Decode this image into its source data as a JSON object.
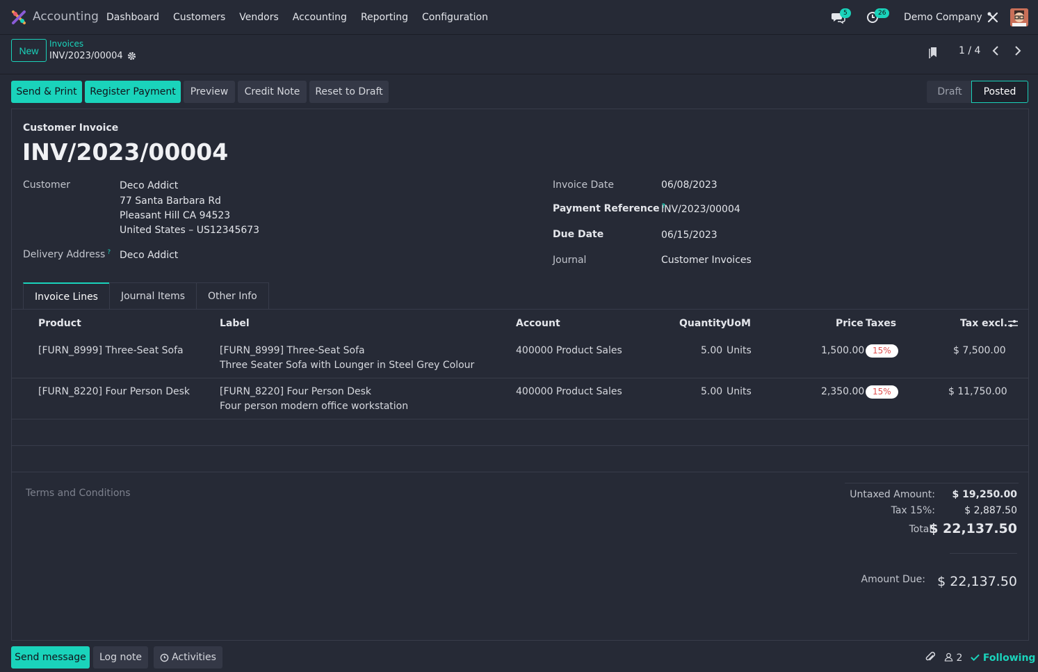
{
  "navbar": {
    "app_name": "Accounting",
    "menu": [
      "Dashboard",
      "Customers",
      "Vendors",
      "Accounting",
      "Reporting",
      "Configuration"
    ],
    "messages_count": "5",
    "activities_count": "26",
    "company": "Demo Company"
  },
  "control": {
    "new_label": "New",
    "breadcrumb_parent": "Invoices",
    "breadcrumb_current": "INV/2023/00004",
    "pager": "1 / 4"
  },
  "actions": {
    "send_print": "Send & Print",
    "register_payment": "Register Payment",
    "preview": "Preview",
    "credit_note": "Credit Note",
    "reset_draft": "Reset to Draft",
    "status_draft": "Draft",
    "status_posted": "Posted"
  },
  "invoice": {
    "type": "Customer Invoice",
    "number": "INV/2023/00004",
    "customer_label": "Customer",
    "customer": "Deco Addict",
    "address_line1": "77 Santa Barbara Rd",
    "address_line2": "Pleasant Hill CA 94523",
    "address_line3": "United States – US12345673",
    "delivery_label": "Delivery Address",
    "delivery": "Deco Addict",
    "invoice_date_label": "Invoice Date",
    "invoice_date": "06/08/2023",
    "payment_ref_label": "Payment Reference",
    "payment_ref": "INV/2023/00004",
    "due_date_label": "Due Date",
    "due_date": "06/15/2023",
    "journal_label": "Journal",
    "journal": "Customer Invoices"
  },
  "tabs": [
    "Invoice Lines",
    "Journal Items",
    "Other Info"
  ],
  "lines": {
    "headers": {
      "product": "Product",
      "label": "Label",
      "account": "Account",
      "quantity": "Quantity",
      "uom": "UoM",
      "price": "Price",
      "taxes": "Taxes",
      "tax_excl": "Tax excl."
    },
    "rows": [
      {
        "product": "[FURN_8999] Three-Seat Sofa",
        "label1": "[FURN_8999] Three-Seat Sofa",
        "label2": "Three Seater Sofa with Lounger in Steel Grey Colour",
        "account": "400000 Product Sales",
        "quantity": "5.00",
        "uom": "Units",
        "price": "1,500.00",
        "tax": "15%",
        "subtotal": "$ 7,500.00"
      },
      {
        "product": "[FURN_8220] Four Person Desk",
        "label1": "[FURN_8220] Four Person Desk",
        "label2": "Four person modern office workstation",
        "account": "400000 Product Sales",
        "quantity": "5.00",
        "uom": "Units",
        "price": "2,350.00",
        "tax": "15%",
        "subtotal": "$ 11,750.00"
      }
    ]
  },
  "terms_placeholder": "Terms and Conditions",
  "totals": {
    "untaxed_label": "Untaxed Amount:",
    "untaxed": "$ 19,250.00",
    "tax_label": "Tax 15%:",
    "tax": "$ 2,887.50",
    "total_label": "Total:",
    "total": "$ 22,137.50",
    "due_label": "Amount Due:",
    "due": "$ 22,137.50"
  },
  "chatter": {
    "send_message": "Send message",
    "log_note": "Log note",
    "activities": "Activities",
    "followers": "2",
    "following": "Following"
  },
  "colors": {
    "accent": "#1ad3bb",
    "background": "#262a36",
    "tax_badge": "#e04e4e"
  }
}
